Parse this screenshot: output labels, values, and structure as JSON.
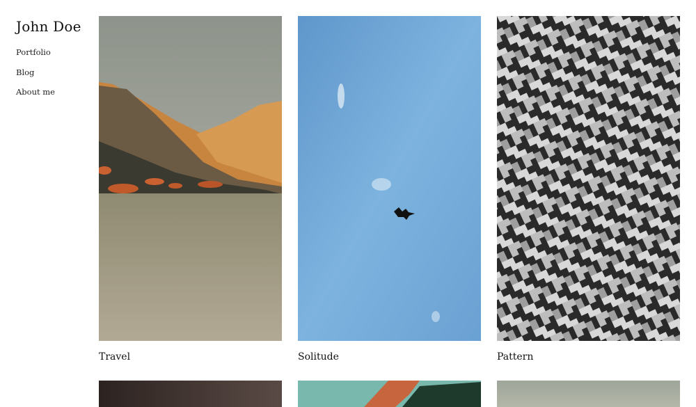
{
  "site": {
    "title": "John Doe"
  },
  "nav": {
    "items": [
      {
        "label": "Portfolio"
      },
      {
        "label": "Blog"
      },
      {
        "label": "About me"
      }
    ]
  },
  "gallery": {
    "items": [
      {
        "caption": "Travel",
        "image": "mountain-landscape"
      },
      {
        "caption": "Solitude",
        "image": "bird-in-sky"
      },
      {
        "caption": "Pattern",
        "image": "paving-pattern"
      }
    ]
  },
  "colors": {
    "text": "#111111",
    "background": "#ffffff"
  }
}
